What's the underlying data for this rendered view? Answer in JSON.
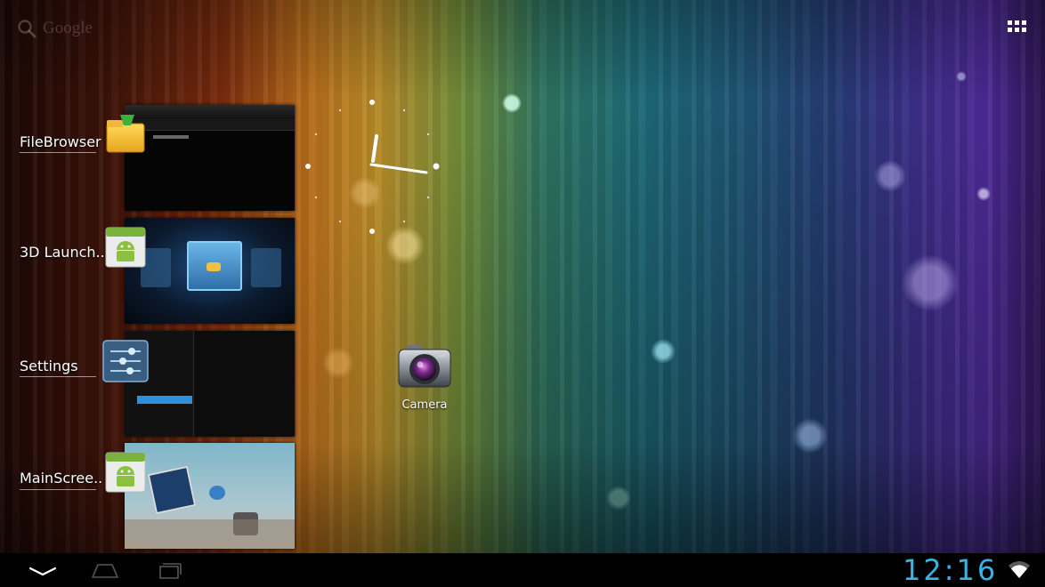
{
  "search": {
    "label": "Google"
  },
  "recent_apps": [
    {
      "label": "FileBrowser",
      "icon": "folder-icon"
    },
    {
      "label": "3D Launch..",
      "icon": "android-icon"
    },
    {
      "label": "Settings",
      "icon": "settings-sliders-icon"
    },
    {
      "label": "MainScree..",
      "icon": "android-icon"
    }
  ],
  "desktop_icons": [
    {
      "label": "Camera",
      "icon": "camera-icon"
    }
  ],
  "status_bar": {
    "time": "12:16"
  },
  "colors": {
    "accent": "#35b5e5"
  }
}
